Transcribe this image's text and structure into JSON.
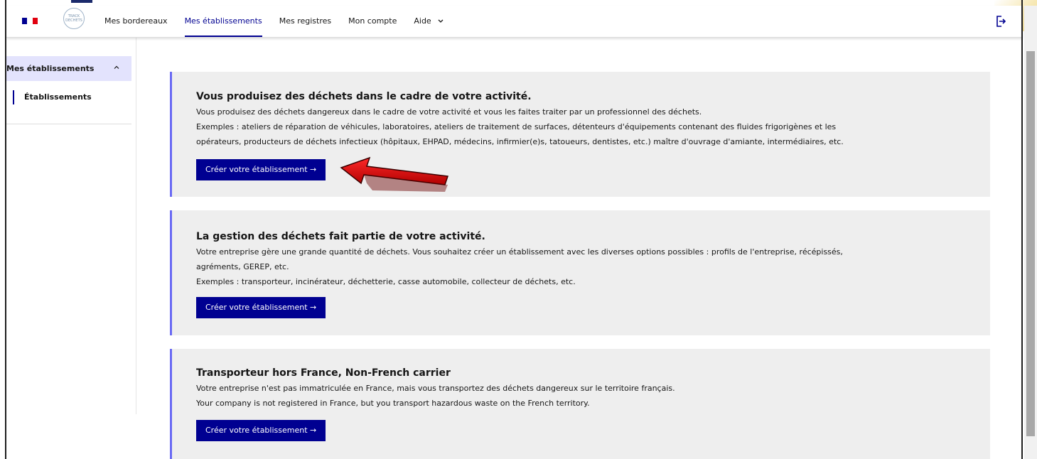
{
  "header": {
    "logo_text": "TRACK DECHETS",
    "nav": [
      {
        "label": "Mes bordereaux",
        "active": false
      },
      {
        "label": "Mes établissements",
        "active": true
      },
      {
        "label": "Mes registres",
        "active": false
      },
      {
        "label": "Mon compte",
        "active": false
      },
      {
        "label": "Aide",
        "active": false
      }
    ]
  },
  "sidebar": {
    "section": "Mes établissements",
    "items": [
      {
        "label": "Établissements"
      }
    ]
  },
  "cards": [
    {
      "title": "Vous produisez des déchets dans le cadre de votre activité.",
      "lines": [
        "Vous produisez des déchets dangereux dans le cadre de votre activité et vous les faites traiter par un professionnel des déchets.",
        "Exemples : ateliers de réparation de véhicules, laboratoires, ateliers de traitement de surfaces, détenteurs d'équipements contenant des fluides frigorigènes et les",
        "opérateurs, producteurs de déchets infectieux (hôpitaux, EHPAD, médecins, infirmier(e)s, tatoueurs, dentistes, etc.) maître d'ouvrage d'amiante, intermédiaires, etc."
      ],
      "button": "Créer votre établissement →"
    },
    {
      "title": "La gestion des déchets fait partie de votre activité.",
      "lines": [
        "Votre entreprise gère une grande quantité de déchets. Vous souhaitez créer un établissement avec les diverses options possibles : profils de l'entreprise, récépissés,",
        "agréments, GEREP, etc.",
        "Exemples : transporteur, incinérateur, déchetterie, casse automobile, collecteur de déchets, etc."
      ],
      "button": "Créer votre établissement →"
    },
    {
      "title": "Transporteur hors France, Non-French carrier",
      "lines": [
        "Votre entreprise n'est pas immatriculée en France, mais vous transportez des déchets dangereux sur le territoire français.",
        "Your company is not registered in France, but you transport hazardous waste on the French territory."
      ],
      "button": "Créer votre établissement →"
    }
  ],
  "colors": {
    "primary": "#000091",
    "card_bg": "#eeeeee",
    "card_accent": "#6a6af4",
    "sidebar_active_bg": "#e3e3fd",
    "annotation_arrow": "#d40000"
  },
  "icons": {
    "logout": "logout-icon",
    "chevron": "chevron-up-icon",
    "aide_chevron": "chevron-down-icon",
    "annotation": "red-arrow-icon"
  }
}
